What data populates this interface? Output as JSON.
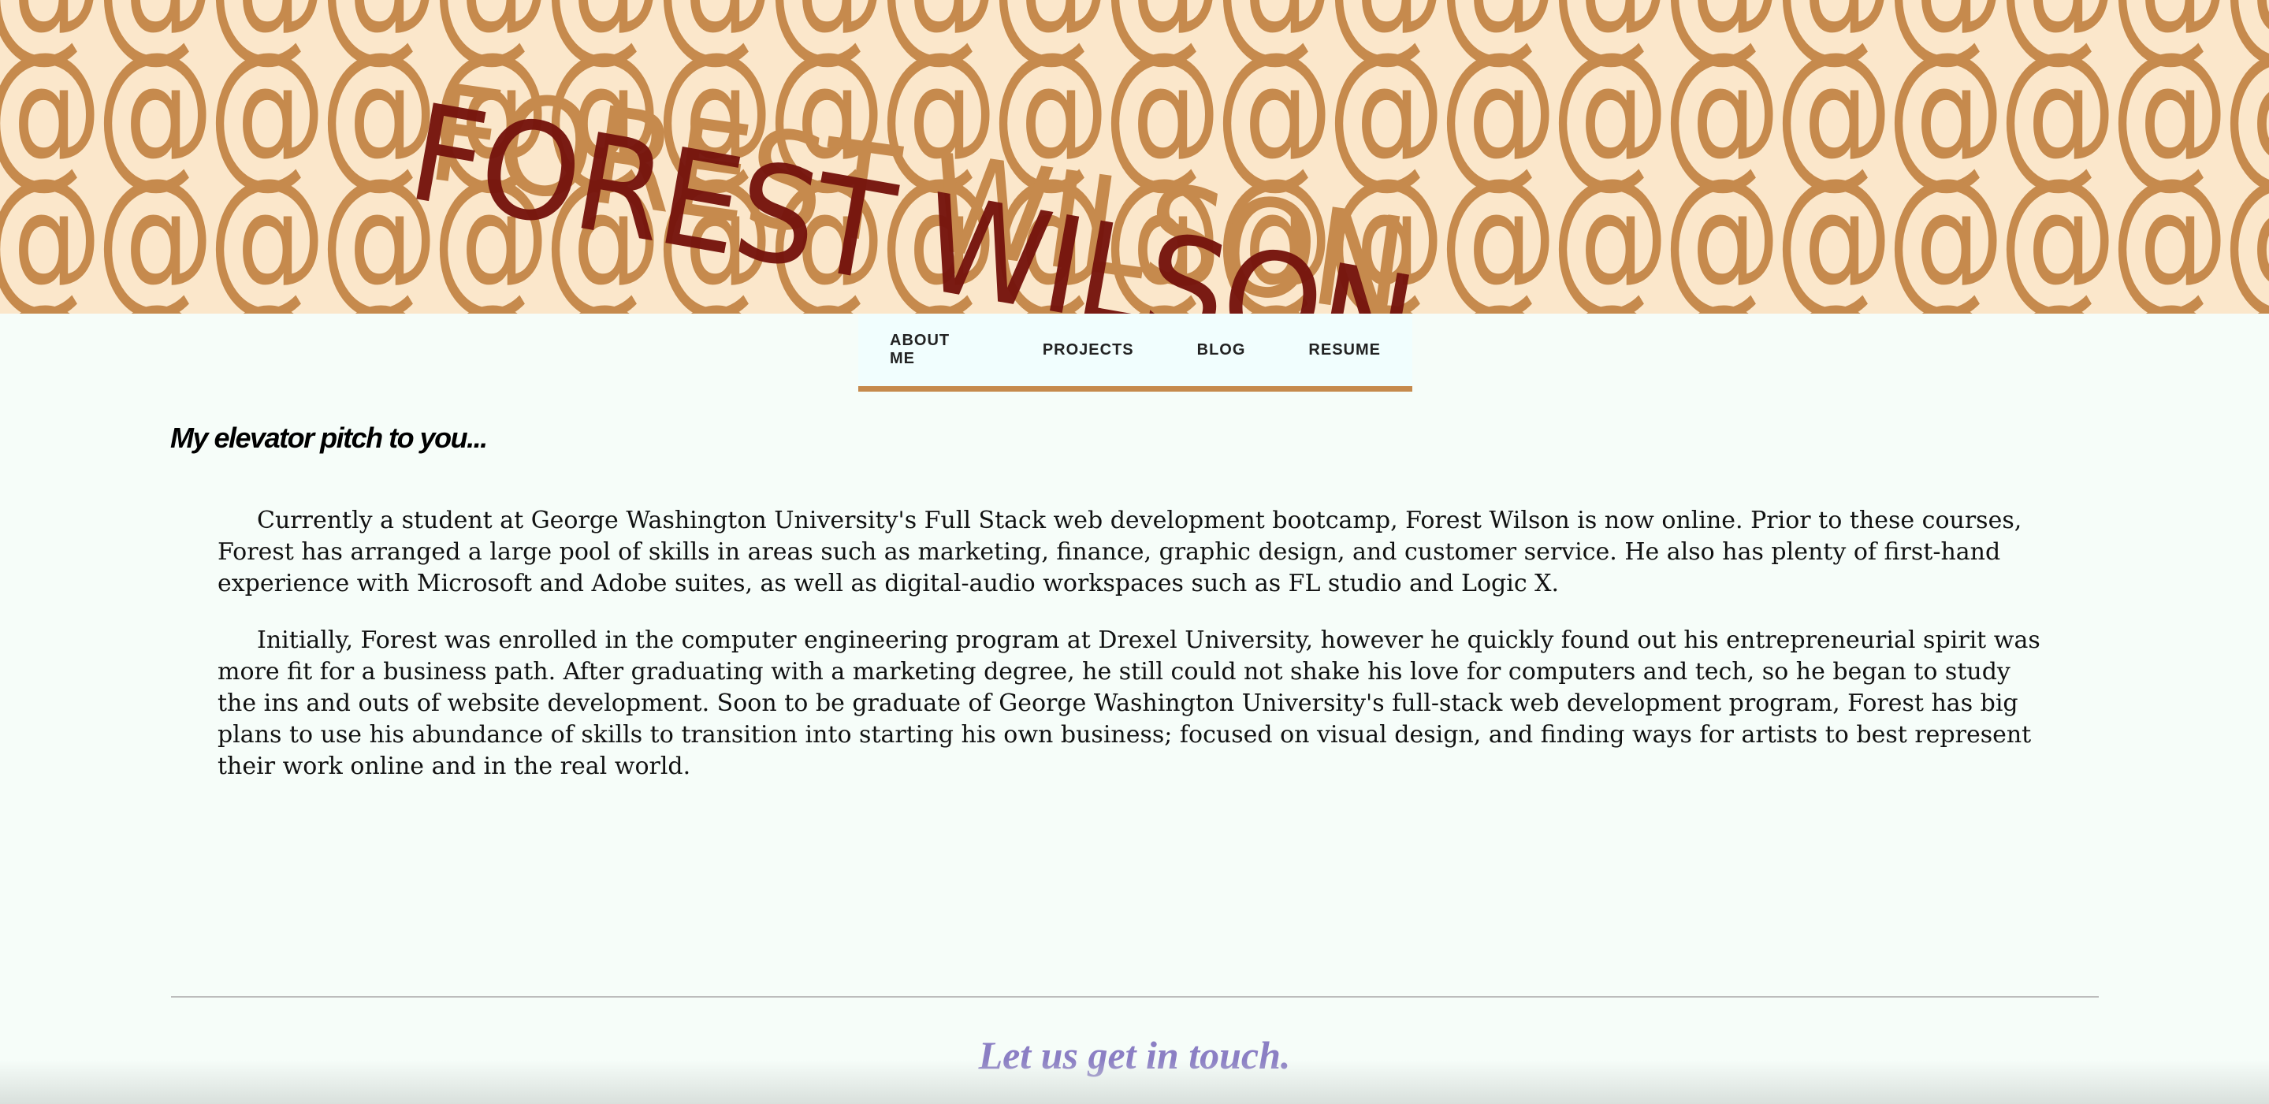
{
  "header": {
    "title": "FOREST WILSON",
    "pattern_glyph": "@",
    "colors": {
      "background": "#fbe7cb",
      "pattern": "#c68a4d",
      "title": "#76150e"
    }
  },
  "nav": {
    "items": [
      {
        "label": "ABOUT ME"
      },
      {
        "label": "PROJECTS"
      },
      {
        "label": "BLOG"
      },
      {
        "label": "RESUME"
      }
    ]
  },
  "main": {
    "heading": "My elevator pitch to you...",
    "paragraphs": [
      "Currently a student at George Washington University's Full Stack web development bootcamp, Forest Wilson is now online. Prior to these courses, Forest has arranged a large pool of skills in areas such as marketing, finance, graphic design, and customer service. He also has plenty of first-hand experience with Microsoft and Adobe suites, as well as digital-audio workspaces such as FL studio and Logic X.",
      "Initially, Forest was enrolled in the computer engineering program at Drexel University, however he quickly found out his entrepreneurial spirit was more fit for a business path. After graduating with a marketing degree, he still could not shake his love for computers and tech, so he began to study the ins and outs of website development. Soon to be graduate of George Washington University's full-stack web development program, Forest has big plans to use his abundance of skills to transition into starting his own business; focused on visual design, and finding ways for artists to best represent their work online and in the real world."
    ]
  },
  "footer": {
    "contact_heading": "Let us get in touch.",
    "accent": "#8b7fc4"
  }
}
